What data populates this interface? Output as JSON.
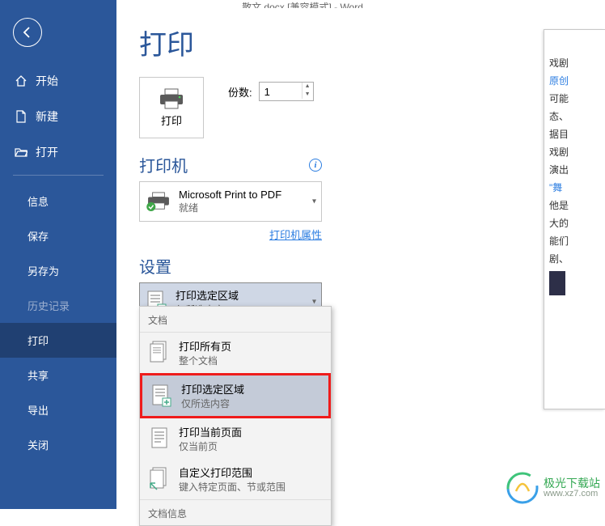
{
  "titlebar": "散文.docx [兼容模式] - Word",
  "sidebar": {
    "home": "开始",
    "new": "新建",
    "open": "打开",
    "info": "信息",
    "save": "保存",
    "saveas": "另存为",
    "history": "历史记录",
    "print": "打印",
    "share": "共享",
    "export": "导出",
    "close": "关闭"
  },
  "page": {
    "title": "打印",
    "print_button": "打印",
    "copies_label": "份数:",
    "copies_value": "1"
  },
  "printer": {
    "section": "打印机",
    "name": "Microsoft Print to PDF",
    "status": "就绪",
    "props_link": "打印机属性"
  },
  "settings": {
    "title": "设置",
    "selected_main": "打印选定区域",
    "selected_sub": "仅所选内容"
  },
  "dropdown": {
    "group1": "文档",
    "items": [
      {
        "t1": "打印所有页",
        "t2": "整个文档"
      },
      {
        "t1": "打印选定区域",
        "t2": "仅所选内容"
      },
      {
        "t1": "打印当前页面",
        "t2": "仅当前页"
      },
      {
        "t1": "自定义打印范围",
        "t2": "键入特定页面、节或范围"
      }
    ],
    "group2": "文档信息"
  },
  "preview": {
    "lines": [
      "戏剧",
      "原创",
      "可能",
      "态、",
      "据目",
      "戏剧",
      "演出",
      "\"舞",
      "他是",
      "大的",
      "能们",
      "剧、"
    ]
  },
  "watermark": {
    "name": "极光下载站",
    "url": "www.xz7.com"
  }
}
